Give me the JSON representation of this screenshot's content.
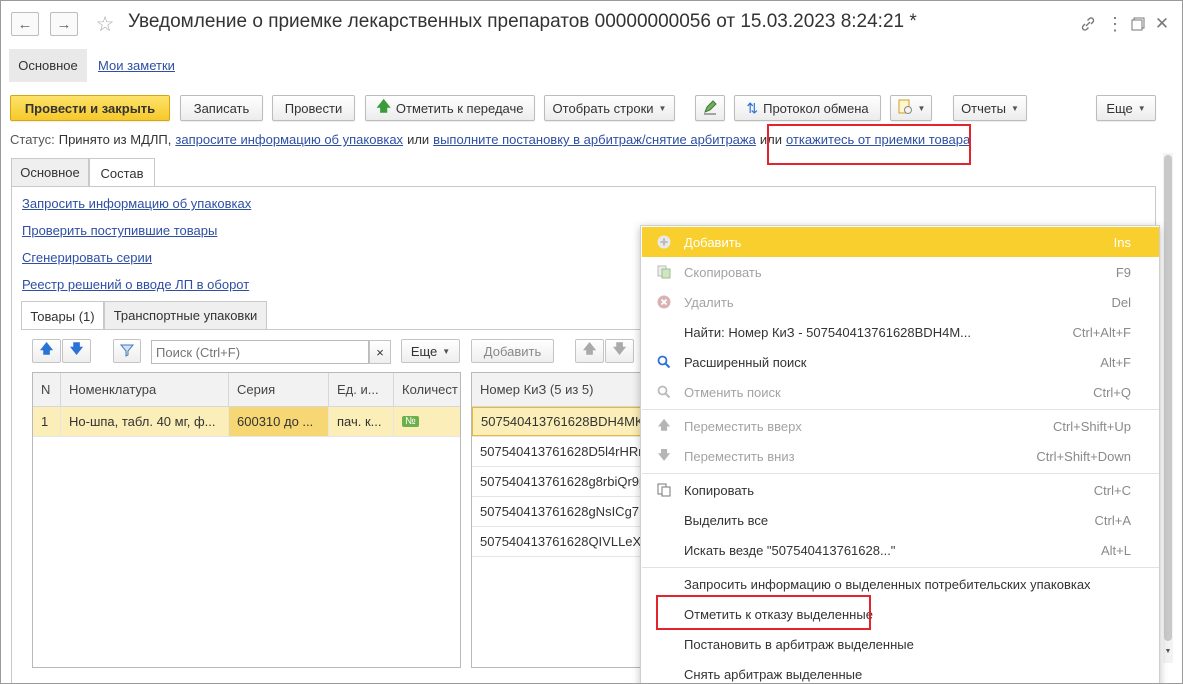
{
  "window": {
    "title": "Уведомление о приемке лекарственных препаратов 00000000056 от 15.03.2023 8:24:21 *",
    "title_icons": [
      "back-arrow-icon",
      "forward-arrow-icon",
      "star-icon",
      "link-icon",
      "more-dots-icon",
      "restore-window-icon",
      "close-icon"
    ]
  },
  "nav_tabs": [
    {
      "label": "Основное"
    },
    {
      "label": "Мои заметки"
    }
  ],
  "toolbar": {
    "post_close": "Провести и закрыть",
    "save": "Записать",
    "post": "Провести",
    "mark_transfer": "Отметить к передаче",
    "select_rows": "Отобрать строки",
    "exchange_protocol": "Протокол обмена",
    "reports": "Отчеты",
    "more": "Еще"
  },
  "status": {
    "prefix": "Статус:",
    "text": "Принято из МДЛП,",
    "link1": "запросите информацию об упаковках",
    "or1": "или",
    "link2": "выполните постановку в арбитраж/снятие арбитража",
    "or2": "или",
    "link3": "откажитесь от приемки товара"
  },
  "form_tabs": [
    {
      "label": "Основное"
    },
    {
      "label": "Состав"
    }
  ],
  "actions": [
    {
      "label": "Запросить информацию об упаковках"
    },
    {
      "label": "Проверить поступившие товары"
    },
    {
      "label": "Сгенерировать серии"
    },
    {
      "label": "Реестр решений о вводе ЛП в оборот"
    }
  ],
  "inner_tabs": [
    {
      "label": "Товары (1)"
    },
    {
      "label": "Транспортные упаковки"
    }
  ],
  "goods_panel": {
    "search_placeholder": "Поиск (Ctrl+F)",
    "clear": "×",
    "more": "Еще",
    "columns": [
      "N",
      "Номенклатура",
      "Серия",
      "Ед. и...",
      "Количест"
    ],
    "rows": [
      {
        "n": "1",
        "nomenclature": "Но-шпа, табл. 40 мг, ф...",
        "series": "600310 до ...",
        "unit": "пач. к...",
        "qty_badge": "№"
      }
    ]
  },
  "kiz_panel": {
    "add": "Добавить",
    "column": "Номер КиЗ (5 из 5)",
    "rows": [
      "507540413761628BDH4MK",
      "507540413761628D5l4rHRn",
      "507540413761628g8rbiQr9p",
      "507540413761628gNsICg7L",
      "507540413761628QIVLLeXj"
    ]
  },
  "context_menu": {
    "items": [
      {
        "label": "Добавить",
        "shortcut": "Ins",
        "icon": "plus-circle-icon",
        "disabled": true,
        "highlighted": true
      },
      {
        "label": "Скопировать",
        "shortcut": "F9",
        "icon": "copy-doc-icon",
        "disabled": true
      },
      {
        "label": "Удалить",
        "shortcut": "Del",
        "icon": "delete-circle-icon",
        "disabled": true
      },
      {
        "label": "Найти: Номер КиЗ - 507540413761628BDH4M...",
        "shortcut": "Ctrl+Alt+F",
        "icon": "",
        "disabled": false
      },
      {
        "label": "Расширенный поиск",
        "shortcut": "Alt+F",
        "icon": "search-icon",
        "disabled": false
      },
      {
        "label": "Отменить поиск",
        "shortcut": "Ctrl+Q",
        "icon": "cancel-search-icon",
        "disabled": true
      },
      {
        "label": "Переместить вверх",
        "shortcut": "Ctrl+Shift+Up",
        "icon": "arrow-up-icon",
        "disabled": true
      },
      {
        "label": "Переместить вниз",
        "shortcut": "Ctrl+Shift+Down",
        "icon": "arrow-down-icon",
        "disabled": true
      },
      {
        "label": "Копировать",
        "shortcut": "Ctrl+C",
        "icon": "copy-icon",
        "disabled": false
      },
      {
        "label": "Выделить все",
        "shortcut": "Ctrl+A",
        "icon": "",
        "disabled": false
      },
      {
        "label": "Искать везде \"507540413761628...\"",
        "shortcut": "Alt+L",
        "icon": "",
        "disabled": false
      },
      {
        "label": "Запросить информацию о выделенных потребительских упаковках",
        "shortcut": "",
        "icon": "",
        "disabled": false
      },
      {
        "label": "Отметить к отказу выделенные",
        "shortcut": "",
        "icon": "",
        "disabled": false,
        "annotated": true
      },
      {
        "label": "Постановить в арбитраж выделенные",
        "shortcut": "",
        "icon": "",
        "disabled": false
      },
      {
        "label": "Снять арбитраж выделенные",
        "shortcut": "",
        "icon": "",
        "disabled": false
      }
    ]
  },
  "colors": {
    "accent_yellow": "#f6c92a",
    "link_blue": "#2e4fa3",
    "annotation_red": "#e3242b",
    "selection_yellow": "#fbeeb8",
    "toolbar_green": "#3b9a3b",
    "toolbar_blue": "#2b72d6"
  }
}
